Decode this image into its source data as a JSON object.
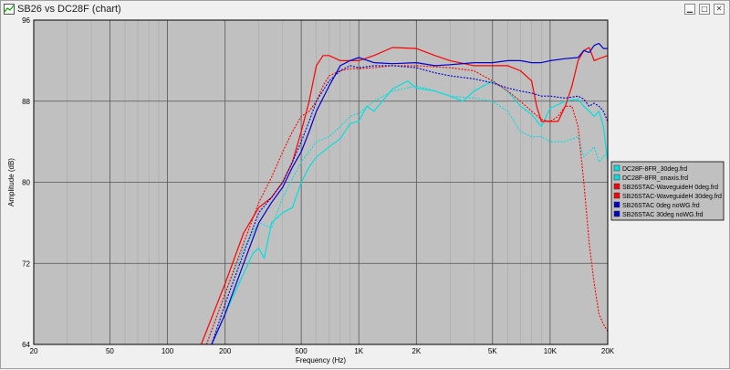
{
  "window": {
    "title": "SB26 vs DC28F  (chart)",
    "minimize_glyph": "▁",
    "maximize_glyph": "□",
    "close_glyph": "✕"
  },
  "chart_data": {
    "type": "line",
    "xlabel": "Frequency (Hz)",
    "ylabel": "Amplitude (dB)",
    "x_scale": "log",
    "xlim": [
      20,
      20000
    ],
    "ylim": [
      64,
      96
    ],
    "x_ticks": [
      20,
      50,
      100,
      200,
      500,
      1000,
      2000,
      5000,
      10000,
      20000
    ],
    "x_tick_labels": [
      "20",
      "50",
      "100",
      "200",
      "500",
      "1K",
      "2K",
      "5K",
      "10K",
      "20K"
    ],
    "x_minor_gridlines": [
      30,
      40,
      60,
      70,
      80,
      90,
      300,
      400,
      600,
      700,
      800,
      900,
      3000,
      4000,
      6000,
      7000,
      8000,
      9000
    ],
    "y_ticks": [
      64,
      72,
      80,
      88,
      96
    ],
    "grid": true,
    "plot_background": "#c0c0c0",
    "legend_position": "right",
    "series": [
      {
        "name": "DC28F-8FR_30deg.frd",
        "color": "#00e0e0",
        "dash": "dotted",
        "points": [
          [
            160,
            64
          ],
          [
            200,
            69
          ],
          [
            250,
            73.5
          ],
          [
            300,
            76
          ],
          [
            350,
            75.5
          ],
          [
            400,
            78.5
          ],
          [
            500,
            82
          ],
          [
            600,
            84
          ],
          [
            700,
            84.5
          ],
          [
            800,
            85.5
          ],
          [
            900,
            86.5
          ],
          [
            1000,
            86.8
          ],
          [
            1200,
            88
          ],
          [
            1500,
            89
          ],
          [
            2000,
            89.5
          ],
          [
            2500,
            89
          ],
          [
            3000,
            88.5
          ],
          [
            4000,
            88.3
          ],
          [
            5000,
            88
          ],
          [
            6000,
            87
          ],
          [
            7000,
            85
          ],
          [
            8000,
            84.5
          ],
          [
            9000,
            84.5
          ],
          [
            10000,
            84
          ],
          [
            12000,
            84
          ],
          [
            14000,
            84.5
          ],
          [
            15000,
            82.5
          ],
          [
            17000,
            83.5
          ],
          [
            18000,
            82
          ],
          [
            20000,
            83
          ]
        ]
      },
      {
        "name": "DC28F-8FR_onaxis.frd",
        "color": "#00e0e0",
        "dash": "solid",
        "points": [
          [
            170,
            64
          ],
          [
            200,
            67
          ],
          [
            250,
            71
          ],
          [
            280,
            73
          ],
          [
            300,
            73.5
          ],
          [
            320,
            72.5
          ],
          [
            350,
            76
          ],
          [
            400,
            77
          ],
          [
            450,
            77.5
          ],
          [
            500,
            80
          ],
          [
            550,
            81.5
          ],
          [
            600,
            82.5
          ],
          [
            700,
            83.5
          ],
          [
            800,
            84.3
          ],
          [
            900,
            85.8
          ],
          [
            1000,
            86
          ],
          [
            1100,
            87.5
          ],
          [
            1200,
            87
          ],
          [
            1500,
            89.2
          ],
          [
            1800,
            90
          ],
          [
            2000,
            89.3
          ],
          [
            2500,
            89
          ],
          [
            3000,
            88.5
          ],
          [
            3500,
            88
          ],
          [
            4000,
            89
          ],
          [
            5000,
            90
          ],
          [
            6000,
            89
          ],
          [
            7000,
            87.5
          ],
          [
            8000,
            86.7
          ],
          [
            9000,
            85.5
          ],
          [
            10000,
            87.3
          ],
          [
            12000,
            88
          ],
          [
            14000,
            88.2
          ],
          [
            15000,
            87.5
          ],
          [
            16000,
            87
          ],
          [
            17000,
            86.5
          ],
          [
            18000,
            87
          ],
          [
            19000,
            85.5
          ],
          [
            20000,
            82
          ]
        ]
      },
      {
        "name": "SB26STAC-WaveguideH 0deg.frd",
        "color": "#ff0000",
        "dash": "solid",
        "points": [
          [
            150,
            64
          ],
          [
            200,
            70
          ],
          [
            250,
            75
          ],
          [
            300,
            77.5
          ],
          [
            350,
            78.5
          ],
          [
            400,
            80
          ],
          [
            450,
            82
          ],
          [
            500,
            85
          ],
          [
            550,
            88
          ],
          [
            600,
            91.5
          ],
          [
            650,
            92.5
          ],
          [
            700,
            92.5
          ],
          [
            800,
            92
          ],
          [
            900,
            92
          ],
          [
            1000,
            92
          ],
          [
            1200,
            92.5
          ],
          [
            1500,
            93.3
          ],
          [
            2000,
            93.2
          ],
          [
            2500,
            92.5
          ],
          [
            3000,
            92
          ],
          [
            4000,
            91.5
          ],
          [
            5000,
            91.5
          ],
          [
            6000,
            91.5
          ],
          [
            7000,
            91
          ],
          [
            8000,
            90
          ],
          [
            8500,
            87.5
          ],
          [
            9000,
            86
          ],
          [
            10000,
            86
          ],
          [
            11000,
            86
          ],
          [
            12000,
            87.5
          ],
          [
            13000,
            89.5
          ],
          [
            14000,
            92
          ],
          [
            15000,
            93
          ],
          [
            16000,
            93.3
          ],
          [
            17000,
            92
          ],
          [
            18000,
            92.2
          ],
          [
            20000,
            92.5
          ]
        ]
      },
      {
        "name": "SB26STAC-WaveguideH 30deg.frd",
        "color": "#ff0000",
        "dash": "dotted",
        "points": [
          [
            160,
            64
          ],
          [
            200,
            69
          ],
          [
            250,
            74
          ],
          [
            300,
            78
          ],
          [
            350,
            80.5
          ],
          [
            400,
            83
          ],
          [
            450,
            85
          ],
          [
            500,
            86.5
          ],
          [
            550,
            87
          ],
          [
            600,
            88
          ],
          [
            650,
            89.5
          ],
          [
            700,
            90.5
          ],
          [
            800,
            91
          ],
          [
            900,
            91.2
          ],
          [
            1000,
            91.2
          ],
          [
            1200,
            91.3
          ],
          [
            1500,
            91.5
          ],
          [
            2000,
            91.5
          ],
          [
            3000,
            91.3
          ],
          [
            4000,
            91
          ],
          [
            5000,
            90
          ],
          [
            6000,
            89
          ],
          [
            7000,
            88
          ],
          [
            8000,
            87
          ],
          [
            9000,
            86.2
          ],
          [
            10000,
            86
          ],
          [
            11000,
            86.5
          ],
          [
            12000,
            87.5
          ],
          [
            13000,
            87.5
          ],
          [
            14000,
            85.5
          ],
          [
            15000,
            80
          ],
          [
            16000,
            74
          ],
          [
            17000,
            70
          ],
          [
            18000,
            67
          ],
          [
            19000,
            66
          ],
          [
            20000,
            65.3
          ]
        ]
      },
      {
        "name": "SB26STAC 0deg noWG.frd",
        "color": "#0000cc",
        "dash": "solid",
        "points": [
          [
            170,
            64
          ],
          [
            200,
            67
          ],
          [
            250,
            72
          ],
          [
            300,
            76
          ],
          [
            350,
            78
          ],
          [
            400,
            79.5
          ],
          [
            450,
            81.5
          ],
          [
            500,
            83
          ],
          [
            550,
            85
          ],
          [
            600,
            87
          ],
          [
            700,
            89.5
          ],
          [
            800,
            91.5
          ],
          [
            900,
            92
          ],
          [
            1000,
            92.3
          ],
          [
            1200,
            91.8
          ],
          [
            1500,
            91.7
          ],
          [
            2000,
            91.8
          ],
          [
            2500,
            91.5
          ],
          [
            3000,
            91.6
          ],
          [
            4000,
            91.8
          ],
          [
            5000,
            91.8
          ],
          [
            6000,
            92
          ],
          [
            7000,
            92
          ],
          [
            8000,
            91.8
          ],
          [
            9000,
            91.8
          ],
          [
            10000,
            92
          ],
          [
            12000,
            92.2
          ],
          [
            14000,
            92.3
          ],
          [
            15000,
            93
          ],
          [
            16000,
            92.8
          ],
          [
            17000,
            93.5
          ],
          [
            18000,
            93.7
          ],
          [
            19000,
            93.2
          ],
          [
            20000,
            93.2
          ]
        ]
      },
      {
        "name": "SB26STAC 30deg noWG.frd",
        "color": "#0000cc",
        "dash": "dotted",
        "points": [
          [
            170,
            64
          ],
          [
            200,
            68
          ],
          [
            250,
            73
          ],
          [
            300,
            77
          ],
          [
            350,
            78.5
          ],
          [
            400,
            80
          ],
          [
            450,
            82
          ],
          [
            500,
            84
          ],
          [
            550,
            86
          ],
          [
            600,
            88
          ],
          [
            700,
            90
          ],
          [
            800,
            91
          ],
          [
            900,
            91.5
          ],
          [
            1000,
            91.3
          ],
          [
            1200,
            91.5
          ],
          [
            1500,
            91.5
          ],
          [
            2000,
            91.3
          ],
          [
            2500,
            90.8
          ],
          [
            3000,
            90.5
          ],
          [
            4000,
            90.2
          ],
          [
            5000,
            89.8
          ],
          [
            6000,
            89.3
          ],
          [
            7000,
            89
          ],
          [
            8000,
            88.8
          ],
          [
            9000,
            88.5
          ],
          [
            10000,
            88.5
          ],
          [
            12000,
            88.3
          ],
          [
            14000,
            88.5
          ],
          [
            15000,
            88.2
          ],
          [
            16000,
            87.5
          ],
          [
            17000,
            87.8
          ],
          [
            18000,
            87.5
          ],
          [
            19000,
            87
          ],
          [
            20000,
            86
          ]
        ]
      }
    ]
  }
}
